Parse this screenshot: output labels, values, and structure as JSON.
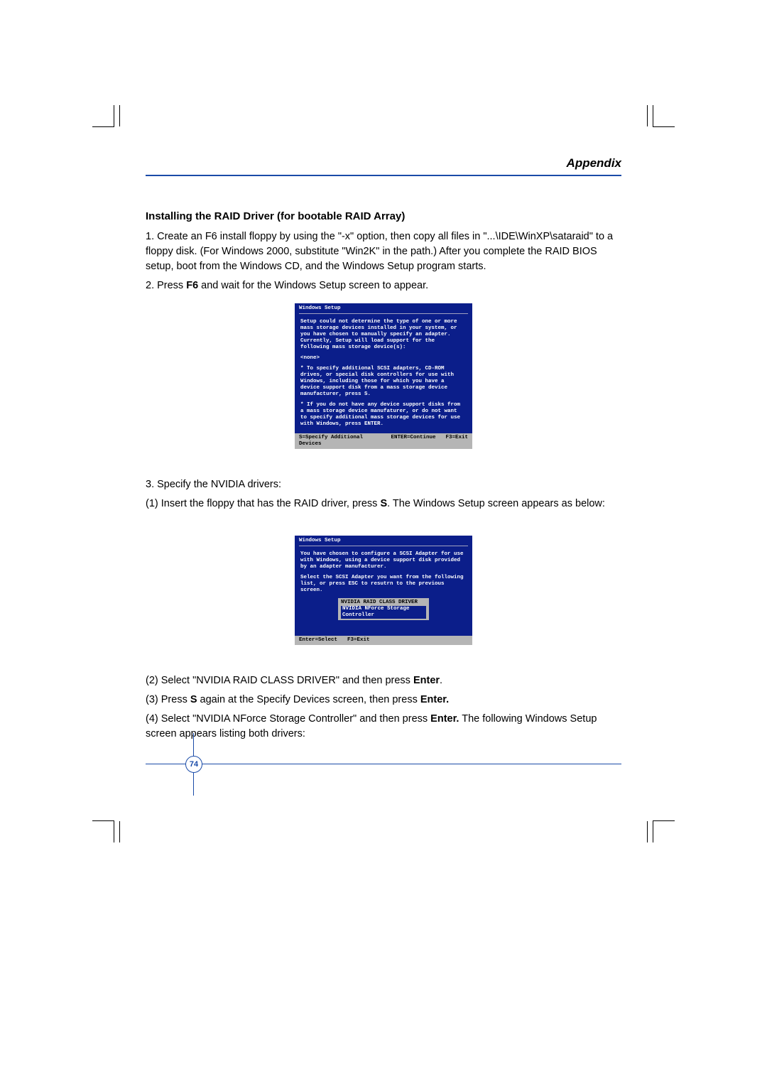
{
  "header": {
    "title": "Appendix"
  },
  "section": {
    "heading": "Installing the RAID Driver (for bootable RAID Array)",
    "p1": "1. Create an F6 install floppy by using the \"-x\" option, then copy all files in \"...\\IDE\\WinXP\\sataraid\" to a floppy disk. (For Windows 2000, substitute \"Win2K\" in the path.) After you complete the RAID BIOS setup, boot from the Windows CD, and the Windows Setup program starts.",
    "p2a": "2. Press ",
    "p2b": "F6",
    "p2c": " and wait for the Windows Setup screen to appear.",
    "p3": "3. Specify the NVIDIA drivers:",
    "p4a": "(1) Insert the floppy that has the RAID driver, press ",
    "p4b": "S",
    "p4c": ". The Windows Setup screen appears as below:",
    "p5a": "(2) Select \"NVIDIA RAID CLASS DRIVER\" and then press ",
    "p5b": "Enter",
    "p5c": ".",
    "p6a": "(3) Press ",
    "p6b": "S",
    "p6c": " again at the Specify Devices screen, then press ",
    "p6d": "Enter.",
    "p7a": "(4) Select \"NVIDIA NForce Storage Controller\" and then press ",
    "p7b": "Enter.",
    "p7c": " The following Windows Setup screen appears listing both drivers:"
  },
  "screen1": {
    "title": "Windows Setup",
    "l1": "Setup could not determine the type of one or more mass storage devices installed in your system, or you have chosen to manually specify an adapter. Currently, Setup will load support for the following mass storage device(s):",
    "none": "<none>",
    "l2": "* To specify additional SCSI adapters, CD-ROM drives, or special disk controllers for use with Windows, including those for which you have a device support disk from a mass storage device manufacturer, press S.",
    "l3": "* If you do not have any device support disks from a mass storage device manufaturer, or do not want to specify additional mass storage devices for use with Windows, press ENTER.",
    "f1": "S=Specify Additional Devices",
    "f2": "ENTER=Continue",
    "f3": "F3=Exit"
  },
  "screen2": {
    "title": "Windows Setup",
    "l1": "You have chosen to configure a SCSI Adapter for use with Windows, using a device support disk provided by an adapter manufacturer.",
    "l2": "Select the SCSI Adapter you want from the following list, or press ESC to resutrn to the previous screen.",
    "opt1": "NVIDIA RAID CLASS DRIVER",
    "opt2": "NVIDIA NForce Storage Controller",
    "f1": "Enter=Select",
    "f2": "F3=Exit"
  },
  "footer": {
    "page": "74"
  }
}
